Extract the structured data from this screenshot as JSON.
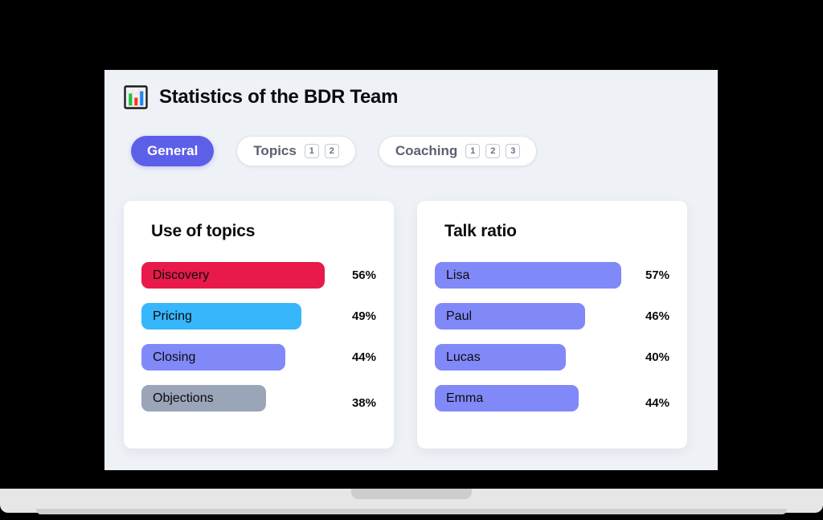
{
  "header": {
    "icon": "bar-chart-icon",
    "title": "Statistics of the BDR Team"
  },
  "tabs": [
    {
      "label": "General",
      "active": true,
      "badges": []
    },
    {
      "label": "Topics",
      "active": false,
      "badges": [
        "1",
        "2"
      ]
    },
    {
      "label": "Coaching",
      "active": false,
      "badges": [
        "1",
        "2",
        "3"
      ]
    }
  ],
  "cards": [
    {
      "title": "Use of topics",
      "rows": [
        {
          "label": "Discovery",
          "value": "56%",
          "pct": 56,
          "color": "#e8194b"
        },
        {
          "label": "Pricing",
          "value": "49%",
          "pct": 49,
          "color": "#37b6fb"
        },
        {
          "label": "Closing",
          "value": "44%",
          "pct": 44,
          "color": "#8189f8"
        },
        {
          "label": "Objections",
          "value": "38%",
          "pct": 38,
          "color": "#9aa5b8"
        }
      ]
    },
    {
      "title": "Talk ratio",
      "rows": [
        {
          "label": "Lisa",
          "value": "57%",
          "pct": 57,
          "color": "#8189f8"
        },
        {
          "label": "Paul",
          "value": "46%",
          "pct": 46,
          "color": "#8189f8"
        },
        {
          "label": "Lucas",
          "value": "40%",
          "pct": 40,
          "color": "#8189f8"
        },
        {
          "label": "Emma",
          "value": "44%",
          "pct": 44,
          "color": "#8189f8"
        }
      ]
    }
  ],
  "colors": {
    "accent": "#5c5fe8",
    "screen_bg": "#eef1f6",
    "card_bg": "#ffffff",
    "frame": "#000000",
    "base": "#e6e6e6"
  },
  "chart_data": [
    {
      "type": "bar",
      "title": "Use of topics",
      "orientation": "horizontal",
      "categories": [
        "Discovery",
        "Pricing",
        "Closing",
        "Objections"
      ],
      "values": [
        56,
        49,
        44,
        38
      ],
      "value_labels": [
        "56%",
        "49%",
        "44%",
        "38%"
      ],
      "colors": [
        "#e8194b",
        "#37b6fb",
        "#8189f8",
        "#9aa5b8"
      ],
      "xlabel": "",
      "ylabel": "",
      "xlim": [
        0,
        100
      ],
      "grid": false,
      "legend": "none"
    },
    {
      "type": "bar",
      "title": "Talk ratio",
      "orientation": "horizontal",
      "categories": [
        "Lisa",
        "Paul",
        "Lucas",
        "Emma"
      ],
      "values": [
        57,
        46,
        40,
        44
      ],
      "value_labels": [
        "57%",
        "46%",
        "40%",
        "44%"
      ],
      "colors": [
        "#8189f8",
        "#8189f8",
        "#8189f8",
        "#8189f8"
      ],
      "xlabel": "",
      "ylabel": "",
      "xlim": [
        0,
        100
      ],
      "grid": false,
      "legend": "none"
    }
  ]
}
